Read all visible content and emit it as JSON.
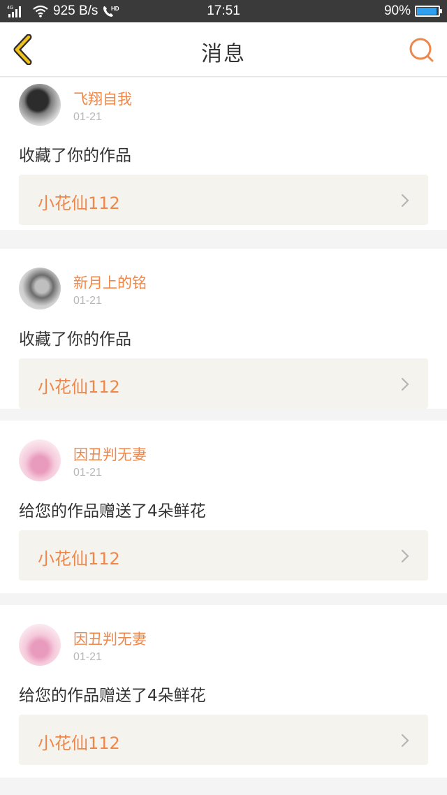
{
  "status_bar": {
    "network": "4G",
    "speed": "925 B/s",
    "hd": "HD",
    "time": "17:51",
    "battery": "90%",
    "battery_color": "#2fa0f0"
  },
  "nav": {
    "title": "消息",
    "back_icon": "chevron-left-icon",
    "search_icon": "search-icon",
    "accent_color": "#f0874a",
    "back_color": "#f2c21a"
  },
  "messages": [
    {
      "username": "飞翔自我",
      "date": "01-21",
      "action": "收藏了你的作品",
      "work_title": "小花仙112"
    },
    {
      "username": "新月上的铭",
      "date": "01-21",
      "action": "收藏了你的作品",
      "work_title": "小花仙112"
    },
    {
      "username": "因丑判无妻",
      "date": "01-21",
      "action": "给您的作品赠送了4朵鲜花",
      "work_title": "小花仙112"
    },
    {
      "username": "因丑判无妻",
      "date": "01-21",
      "action": "给您的作品赠送了4朵鲜花",
      "work_title": "小花仙112"
    }
  ]
}
